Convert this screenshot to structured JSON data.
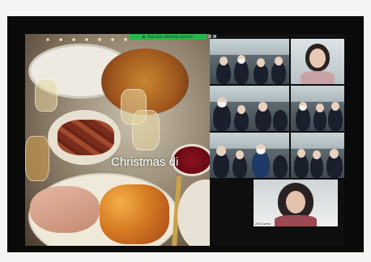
{
  "zoom_toolbar": {
    "label": "You are viewing screen"
  },
  "shared_screen": {
    "slide_title": "Christmas di"
  },
  "participants": [
    {
      "name": ""
    },
    {
      "name": ""
    },
    {
      "name": ""
    },
    {
      "name": ""
    },
    {
      "name": ""
    },
    {
      "name": ""
    },
    {
      "name": "Zoli Csetni"
    }
  ],
  "colors": {
    "zoom_green": "#2db34a",
    "monitor_bezel": "#0a0a0a"
  }
}
